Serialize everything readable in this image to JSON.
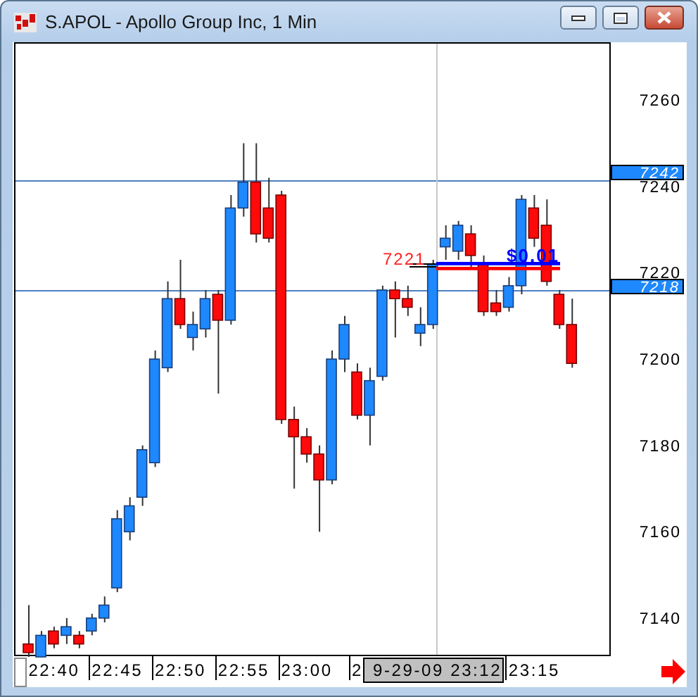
{
  "window": {
    "title": "S.APOL - Apollo Group Inc, 1 Min"
  },
  "chart": {
    "price_tags": [
      {
        "label": "7242"
      },
      {
        "label": "7218"
      }
    ],
    "order_label": "7221",
    "pnl_label": "$0.01",
    "cursor_time": "9-29-09 23:12",
    "chart_data": {
      "type": "candlestick",
      "ylim": [
        7131.5,
        7273.4
      ],
      "yticks": [
        7260,
        7240,
        7220,
        7200,
        7180,
        7160,
        7140
      ],
      "categories": [
        null,
        null,
        "22:40",
        null,
        null,
        null,
        null,
        "22:45",
        null,
        null,
        null,
        null,
        "22:50",
        null,
        null,
        null,
        null,
        "22:55",
        null,
        null,
        null,
        null,
        "23:00",
        null,
        null,
        null,
        "2",
        null,
        null,
        null,
        null,
        null,
        null,
        null,
        null,
        null,
        null,
        null,
        null,
        null,
        "23:15",
        null,
        null,
        null
      ],
      "ohlc": [
        [
          7134,
          7143,
          7131,
          7132
        ],
        [
          7131,
          7137,
          7131,
          7136
        ],
        [
          7137,
          7138,
          7133,
          7134
        ],
        [
          7136,
          7140,
          7134,
          7138
        ],
        [
          7136,
          7137,
          7133,
          7134
        ],
        [
          7137,
          7141,
          7136,
          7140
        ],
        [
          7140,
          7145,
          7139,
          7143
        ],
        [
          7147,
          7165,
          7146,
          7163
        ],
        [
          7160,
          7168,
          7158,
          7166
        ],
        [
          7168,
          7180,
          7166,
          7179
        ],
        [
          7176,
          7202,
          7175,
          7200
        ],
        [
          7198,
          7218,
          7197,
          7214
        ],
        [
          7214,
          7223,
          7207,
          7208
        ],
        [
          7205,
          7211,
          7202,
          7208
        ],
        [
          7207,
          7216,
          7205,
          7214
        ],
        [
          7215,
          7216,
          7192,
          7209
        ],
        [
          7209,
          7238,
          7208,
          7235
        ],
        [
          7235,
          7250,
          7233,
          7241
        ],
        [
          7241,
          7250,
          7227,
          7229
        ],
        [
          7235,
          7242,
          7227,
          7228
        ],
        [
          7238,
          7239,
          7185,
          7186
        ],
        [
          7186,
          7189,
          7170,
          7182
        ],
        [
          7182,
          7184,
          7176,
          7178
        ],
        [
          7178,
          7180,
          7160,
          7172
        ],
        [
          7172,
          7202,
          7171,
          7200
        ],
        [
          7200,
          7210,
          7197,
          7208
        ],
        [
          7197,
          7199,
          7186,
          7187
        ],
        [
          7187,
          7198,
          7180,
          7195
        ],
        [
          7196,
          7217,
          7195,
          7216
        ],
        [
          7216,
          7218,
          7205,
          7214
        ],
        [
          7214,
          7217,
          7210,
          7212
        ],
        [
          7206,
          7212,
          7203,
          7208
        ],
        [
          7208,
          7223,
          7207,
          7222
        ],
        [
          7226,
          7231,
          7223,
          7228
        ],
        [
          7225,
          7232,
          7223,
          7231
        ],
        [
          7229,
          7231,
          7221,
          7224
        ],
        [
          7222,
          7224,
          7210,
          7211
        ],
        [
          7213,
          7216,
          7210,
          7211
        ],
        [
          7212,
          7219,
          7211,
          7217
        ],
        [
          7217,
          7238,
          7215,
          7237
        ],
        [
          7235,
          7238,
          7226,
          7228
        ],
        [
          7231,
          7237,
          7217,
          7218
        ],
        [
          7215,
          7216,
          7207,
          7208
        ],
        [
          7208,
          7214,
          7198,
          7199
        ]
      ]
    }
  }
}
